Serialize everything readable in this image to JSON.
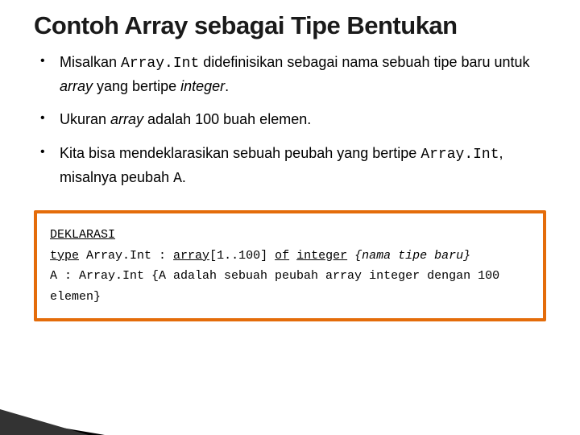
{
  "title": "Contoh Array sebagai Tipe Bentukan",
  "bullets": {
    "b1": {
      "p1": "Misalkan ",
      "code1": "Array.Int",
      "p2": " didefinisikan sebagai nama sebuah tipe baru untuk ",
      "it1": "array",
      "p3": " yang bertipe ",
      "it2": "integer",
      "p4": "."
    },
    "b2": {
      "p1": "Ukuran ",
      "it1": "array",
      "p2": " adalah 100 buah elemen."
    },
    "b3": {
      "p1": "Kita bisa mendeklarasikan sebuah peubah yang bertipe ",
      "code1": "Array.Int",
      "p2": ", misalnya peubah ",
      "code2": "A",
      "p3": "."
    }
  },
  "codebox": {
    "l1": {
      "kw": "DEKLARASI"
    },
    "l2": {
      "kw1": "type",
      "t1": " Array.Int : ",
      "kw2": "array",
      "t2": "[1..100] ",
      "kw3": "of",
      "t3": " ",
      "kw4": "integer",
      "t4": " ",
      "comment": "{nama tipe baru}"
    },
    "l3": {
      "t1": "A : Array.Int {A adalah sebuah peubah array integer dengan 100 elemen}"
    }
  }
}
